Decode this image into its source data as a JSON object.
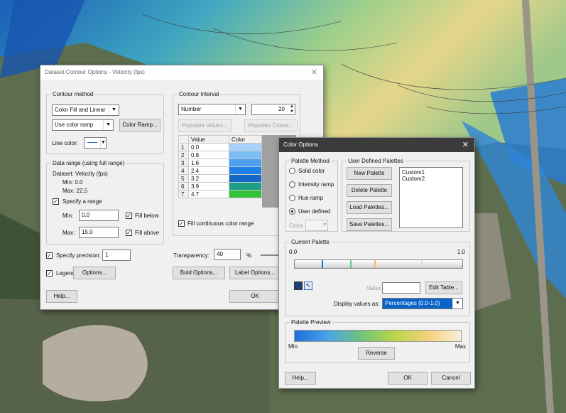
{
  "dataset_dialog": {
    "title": "Dataset Contour Options - Velocity (fps)",
    "contour_method": {
      "label": "Contour method",
      "method_value": "Color Fill and Linear",
      "ramp_value": "Use color ramp",
      "color_ramp_button": "Color Ramp...",
      "line_color_label": "Line color:"
    },
    "data_range": {
      "label": "Data range (using full range)",
      "dataset_text": "Dataset:  Velocity (fps)",
      "min_text": "Min:  0.0",
      "max_text": "Max:  22.5",
      "specify_range_label": "Specify a range",
      "min_label": "Min:",
      "min_value": "0.0",
      "max_label": "Max:",
      "max_value": "15.0",
      "fill_below_label": "Fill below",
      "fill_above_label": "Fill above"
    },
    "contour_interval": {
      "label": "Contour interval",
      "type_value": "Number",
      "count_value": "20",
      "populate_values_button": "Populate Values...",
      "populate_colors_button": "Populate Colors...",
      "table_headers": [
        "",
        "Value",
        "Color"
      ],
      "rows": [
        {
          "n": "1",
          "value": "0.0",
          "color": "#a8d0f8"
        },
        {
          "n": "2",
          "value": "0.8",
          "color": "#7bbdf4"
        },
        {
          "n": "3",
          "value": "1.6",
          "color": "#4a9ff0"
        },
        {
          "n": "4",
          "value": "2.4",
          "color": "#1f7fe8"
        },
        {
          "n": "5",
          "value": "3.2",
          "color": "#1668c8"
        },
        {
          "n": "6",
          "value": "3.9",
          "color": "#1e9e84"
        },
        {
          "n": "7",
          "value": "4.7",
          "color": "#31c23a"
        }
      ],
      "fill_continuous_label": "Fill continuous color range"
    },
    "specify_precision_label": "Specify precision:",
    "precision_value": "1",
    "legend_label": "Legend:",
    "options_button": "Options...",
    "transparency_label": "Transparency:",
    "transparency_value": "40",
    "transparency_unit": "%",
    "bold_options_button": "Bold Options...",
    "label_options_button": "Label Options...",
    "help_button": "Help...",
    "ok_button": "OK"
  },
  "color_options": {
    "title": "Color Options",
    "palette_method": {
      "label": "Palette Method",
      "options": [
        "Solid color",
        "Intensity ramp",
        "Hue ramp",
        "User defined"
      ],
      "selected": "User defined",
      "color_label": "Color:"
    },
    "user_defined": {
      "label": "User Defined Palettes",
      "new_button": "New Palette",
      "delete_button": "Delete Palette",
      "load_button": "Load Palettes...",
      "save_button": "Save Palettes...",
      "palettes": [
        "Custom1",
        "Custom2"
      ]
    },
    "current_palette": {
      "label": "Current Palette",
      "min_tick": "0.0",
      "max_tick": "1.0",
      "value_label": "Value:",
      "value": "",
      "edit_table_button": "Edit Table...",
      "display_label": "Display values as:",
      "display_value": "Percentages (0.0-1.0)"
    },
    "preview": {
      "label": "Palette Preview",
      "min_label": "Min",
      "max_label": "Max",
      "reverse_button": "Reverse"
    },
    "help_button": "Help...",
    "ok_button": "OK",
    "cancel_button": "Cancel"
  },
  "colors": {
    "ramp": [
      "#1e6fd9",
      "#4aa3e8",
      "#6fc37a",
      "#b9d64a",
      "#f3d07a",
      "#fbeed8"
    ],
    "selected_combo": "#0a64c8"
  }
}
